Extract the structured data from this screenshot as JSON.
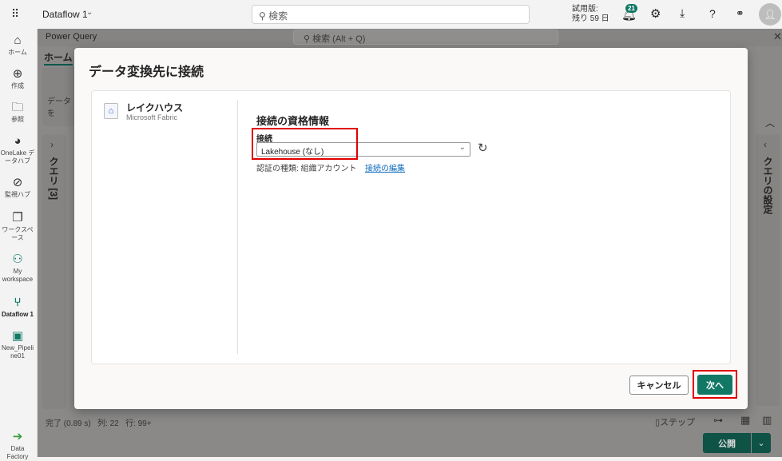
{
  "topbar": {
    "app_title": "Dataflow 1",
    "search_placeholder": "検索",
    "trial_line1": "試用版:",
    "trial_line2": "残り 59 日",
    "notification_count": "21"
  },
  "nav": [
    {
      "label": "ホーム",
      "icon": "home-icon"
    },
    {
      "label": "作成",
      "icon": "plus-circle-icon"
    },
    {
      "label": "参照",
      "icon": "folder-icon"
    },
    {
      "label": "OneLake データハブ",
      "icon": "onelake-icon"
    },
    {
      "label": "監視ハブ",
      "icon": "monitor-icon"
    },
    {
      "label": "ワークスペース",
      "icon": "workspaces-icon"
    },
    {
      "label": "My workspace",
      "icon": "my-workspace-icon"
    },
    {
      "label": "Dataflow 1",
      "icon": "dataflow-icon"
    },
    {
      "label": "New_Pipeline01",
      "icon": "pipeline-icon"
    },
    {
      "label": "Data Factory",
      "icon": "data-factory-icon"
    }
  ],
  "pq": {
    "title": "Power Query",
    "search_placeholder": "検索 (Alt + Q)",
    "tab_home": "ホーム",
    "get_data": "データを",
    "queries_pane": "クエリ [3]",
    "settings_pane": "クエリの設定",
    "status_done": "完了 (0.89 s)",
    "status_cols": "列: 22",
    "status_rows": "行: 99+",
    "steps": "ステップ",
    "publish": "公開"
  },
  "dialog": {
    "title": "データ変換先に接続",
    "source_name": "レイクハウス",
    "source_vendor": "Microsoft Fabric",
    "section_title": "接続の資格情報",
    "connection_label": "接続",
    "connection_value": "Lakehouse (なし)",
    "auth_text": "認証の種類: 組織アカウント",
    "edit_link": "接続の編集",
    "cancel": "キャンセル",
    "next": "次へ"
  },
  "colors": {
    "accent": "#117865",
    "highlight": "#e00000"
  }
}
